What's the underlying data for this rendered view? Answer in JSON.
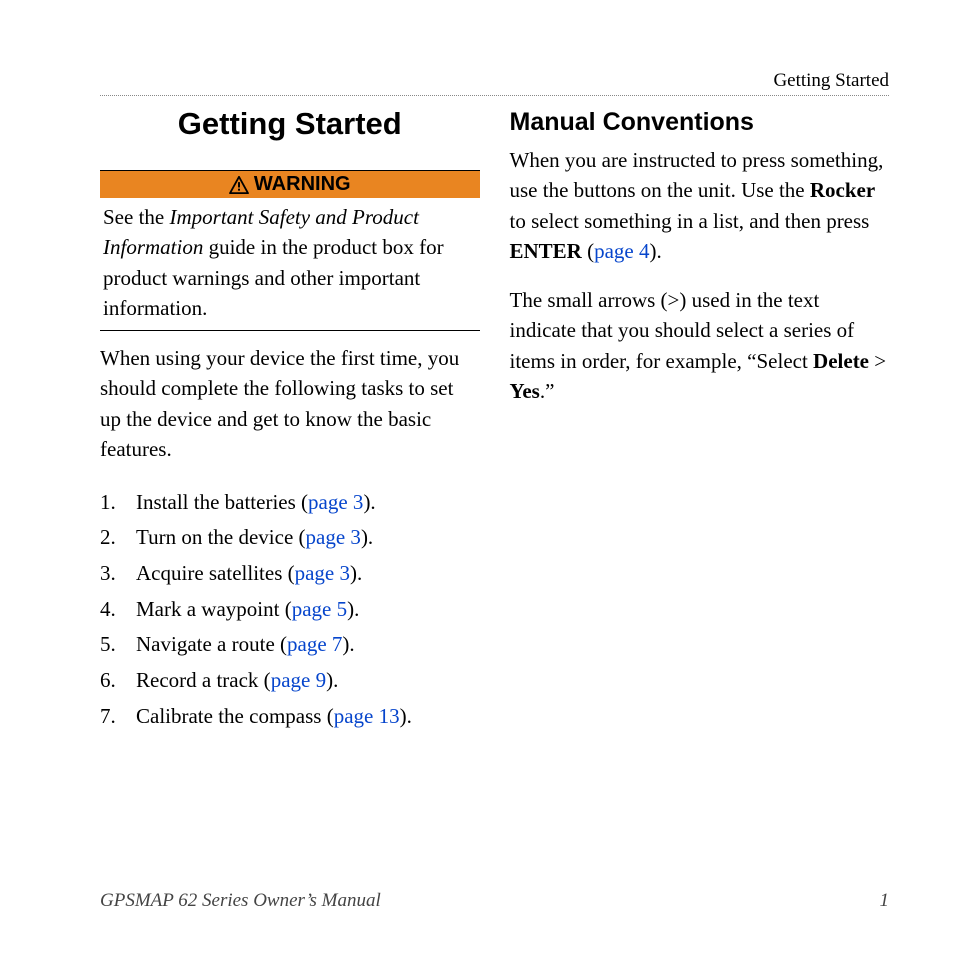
{
  "header": {
    "breadcrumb": "Getting Started"
  },
  "left": {
    "title": "Getting Started",
    "warning": {
      "label": "WARNING",
      "body": {
        "pre": "See the ",
        "italic": "Important Safety and Product Information",
        "post": " guide in the product box for product warnings and other important information."
      }
    },
    "intro": "When using your device the first time, you should complete the following tasks to set up the device and get to know the basic features.",
    "steps": [
      {
        "num": "1.",
        "text": "Install the batteries (",
        "link": "page 3",
        "after": ")."
      },
      {
        "num": "2.",
        "text": "Turn on the device (",
        "link": "page 3",
        "after": ")."
      },
      {
        "num": "3.",
        "text": "Acquire satellites (",
        "link": "page 3",
        "after": ")."
      },
      {
        "num": "4.",
        "text": "Mark a waypoint (",
        "link": "page 5",
        "after": ")."
      },
      {
        "num": "5.",
        "text": "Navigate a route (",
        "link": "page 7",
        "after": ")."
      },
      {
        "num": "6.",
        "text": "Record a track (",
        "link": "page 9",
        "after": ")."
      },
      {
        "num": "7.",
        "text": "Calibrate the compass (",
        "link": "page 13",
        "after": ")."
      }
    ]
  },
  "right": {
    "subtitle": "Manual Conventions",
    "para1": {
      "seg1": "When you are instructed to press something, use the buttons on the unit. Use the ",
      "bold1": "Rocker",
      "seg2": " to select something in a list, and then press ",
      "bold2": "ENTER",
      "seg3": " (",
      "link": "page 4",
      "seg4": ")."
    },
    "para2": {
      "seg1": "The small arrows (>) used in the text indicate that you should select a series of items in order, for example, “Select ",
      "bold1": "Delete",
      "seg2": " > ",
      "bold2": "Yes",
      "seg3": ".”"
    }
  },
  "footer": {
    "left": "GPSMAP 62 Series Owner’s Manual",
    "right": "1"
  }
}
